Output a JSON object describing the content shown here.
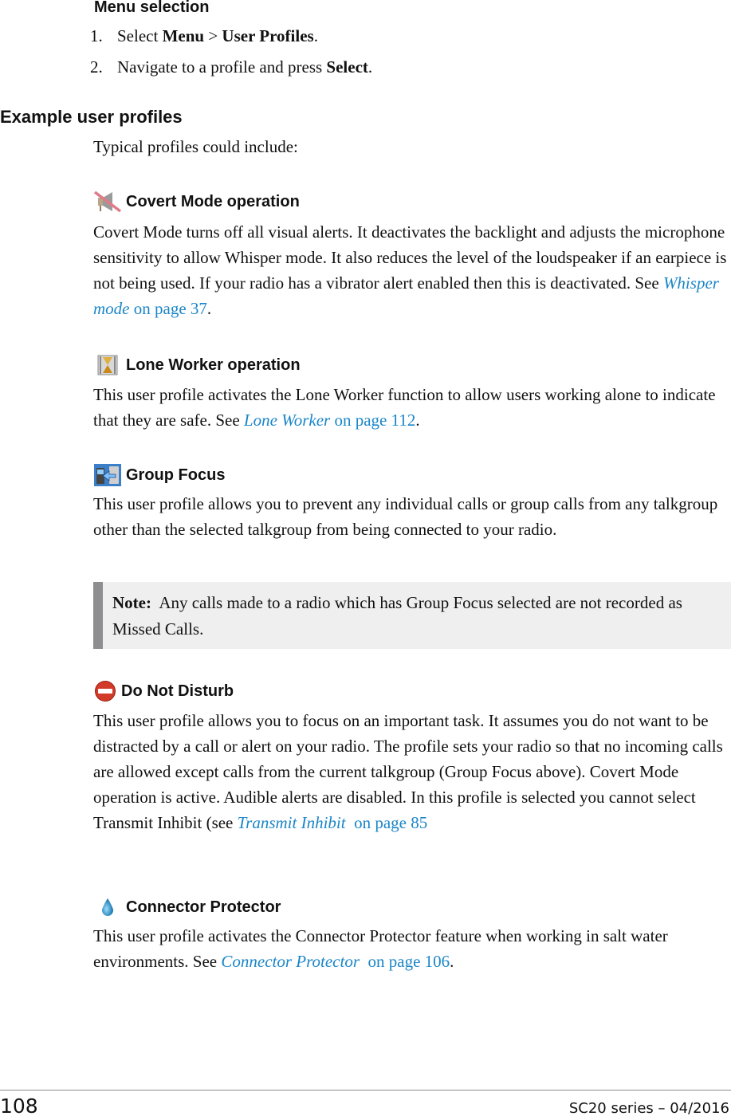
{
  "menu_selection": {
    "heading": "Menu selection",
    "steps": [
      {
        "num": "1.",
        "pre": "Select ",
        "b1": "Menu",
        "mid": " > ",
        "b2": "User Profiles",
        "post": "."
      },
      {
        "num": "2.",
        "pre": "Navigate to a profile and press ",
        "b1": "Select",
        "post": "."
      }
    ]
  },
  "example": {
    "heading": "Example user profiles",
    "intro": "Typical profiles could include:"
  },
  "profiles": {
    "covert": {
      "icon": "speaker-muted-icon",
      "title": "Covert Mode operation",
      "text": "Covert Mode turns off all visual alerts. It deactivates the backlight and adjusts the microphone sensitivity to allow Whisper mode. It also reduces the level of the loudspeaker if an earpiece is not being used. If your radio has a vibrator alert enabled then this is deactivated. See ",
      "link_title": "Whisper mode",
      "link_page": " on page 37",
      "tail": "."
    },
    "lone": {
      "icon": "hourglass-icon",
      "title": "Lone Worker operation",
      "text": "This user profile activates the Lone Worker function to allow users working alone to indicate that they are safe. See ",
      "link_title": "Lone Worker",
      "link_page": " on page 112",
      "tail": "."
    },
    "group": {
      "icon": "group-focus-icon",
      "title": "Group Focus",
      "text": "This user profile allows you to prevent any individual calls or group calls from any talkgroup other than the selected talkgroup from being connected to your radio."
    },
    "note": {
      "label": "Note:",
      "text": "  Any calls made to a radio which has Group Focus selected are not recorded as Missed Calls."
    },
    "dnd": {
      "icon": "no-entry-icon",
      "title": "Do Not Disturb",
      "text": "This user profile allows you to focus on an important task. It assumes you do not want to be distracted by a call or alert on your radio. The profile sets your radio so that no incoming calls are allowed except calls from the current talkgroup (Group Focus above). Covert Mode operation is active. Audible alerts are disabled. In this profile is selected you cannot select Transmit Inhibit (see ",
      "link_title": "Transmit Inhibit",
      "link_page": "  on page 85",
      "tail": ""
    },
    "connector": {
      "icon": "water-drop-icon",
      "title": "Connector Protector",
      "text": "This user profile activates the Connector Protector feature when working in salt water environments. See ",
      "link_title": "Connector Protector",
      "link_page": "  on page 106",
      "tail": "."
    }
  },
  "footer": {
    "page_number": "108",
    "doc_id": "SC20 series – 04/2016"
  },
  "colors": {
    "link": "#1a86c8",
    "note_bg": "#efefef",
    "note_bar": "#8e8e90"
  }
}
